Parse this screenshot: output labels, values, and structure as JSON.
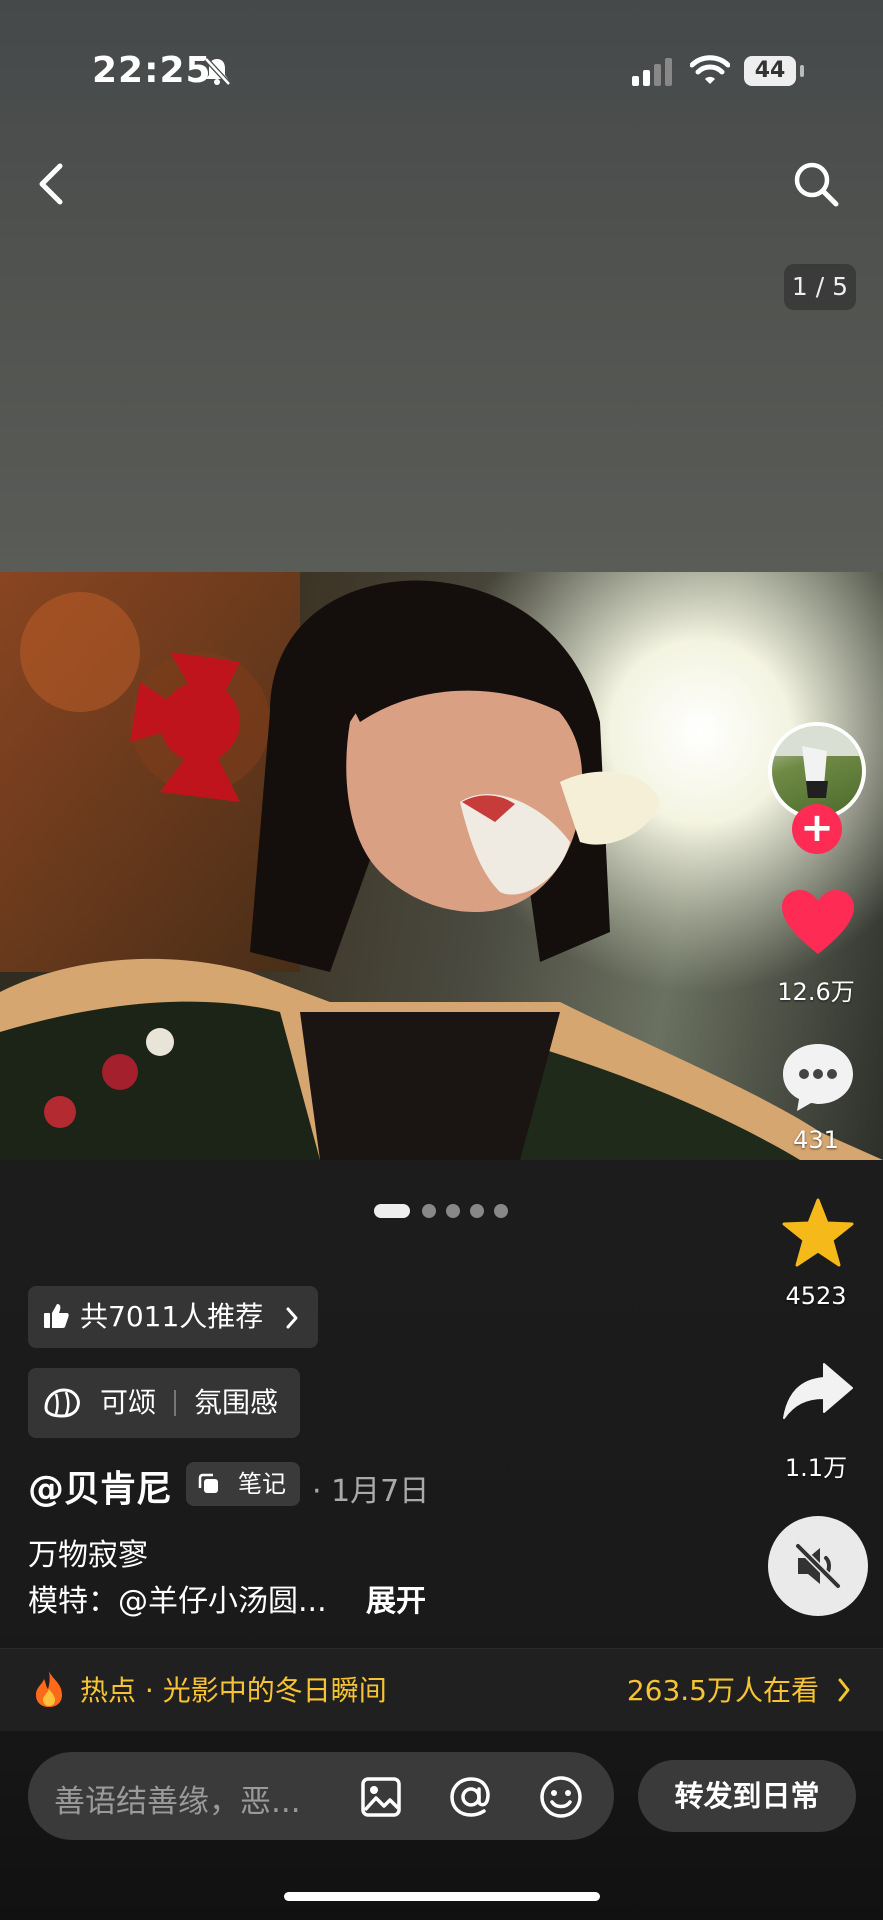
{
  "status_bar": {
    "time": "22:25",
    "battery": "44"
  },
  "header": {
    "page_counter": "1 / 5",
    "back_icon": "chevron-left-icon",
    "search_icon": "search-icon"
  },
  "photo": {
    "page_indicator": {
      "count": 5,
      "active_index": 0
    }
  },
  "rail": {
    "like_count": "12.6万",
    "comment_count": "431",
    "favorite_count": "4523",
    "share_count": "1.1万",
    "follow_label": "+"
  },
  "info": {
    "recommend_label": "共7011人推荐",
    "tag_primary": "可颂",
    "tag_secondary": "氛围感",
    "author": "@贝肯尼",
    "note_badge": "笔记",
    "date": "· 1月7日",
    "desc_line1": "万物寂寥",
    "desc_line2": "模特：@羊仔小汤圆...",
    "expand_label": "展开"
  },
  "hot": {
    "topic": "热点 · 光影中的冬日瞬间",
    "watching": "263.5万人在看"
  },
  "bottom": {
    "comment_placeholder": "善语结善缘，恶...",
    "share_daily_label": "转发到日常"
  },
  "colors": {
    "like": "#fe2c55",
    "favorite": "#f5b91a",
    "hot": "#f5c334"
  }
}
